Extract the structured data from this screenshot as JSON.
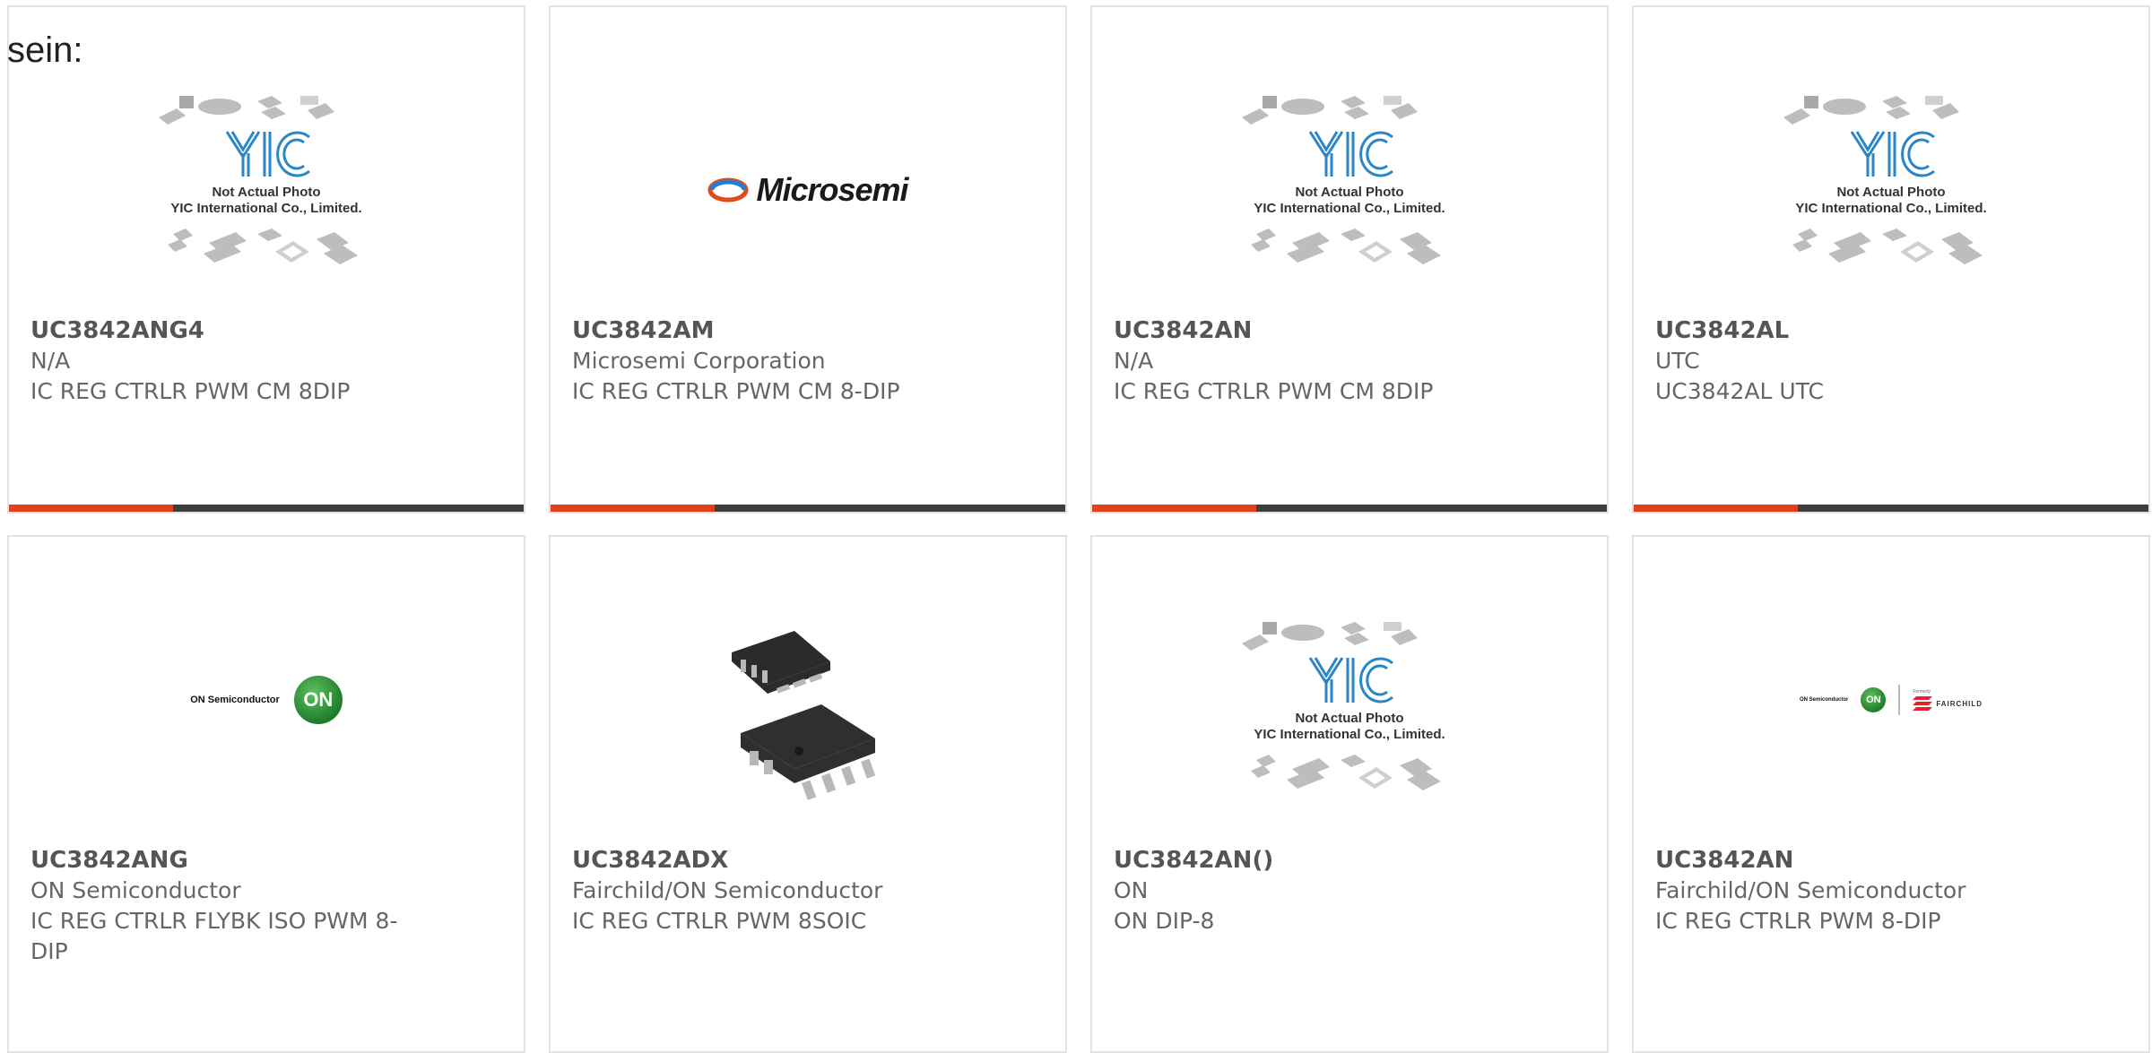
{
  "lead_text": "sein:",
  "colors": {
    "accent": "#e0431c",
    "bar": "#3d3d3d",
    "border": "#e2e2e2"
  },
  "placeholder": {
    "line1": "Not Actual Photo",
    "line2": "YIC International Co., Limited."
  },
  "logos": {
    "microsemi": "Microsemi",
    "on_semiconductor": "ON Semiconductor",
    "on_badge": "ON",
    "fairchild": "FAIRCHILD",
    "fairchild_formerly": "Formerly"
  },
  "products": [
    {
      "part": "UC3842ANG4",
      "manufacturer": "N/A",
      "description": "IC REG CTRLR PWM CM 8DIP",
      "image": "placeholder"
    },
    {
      "part": "UC3842AM",
      "manufacturer": "Microsemi Corporation",
      "description": "IC REG CTRLR PWM CM 8-DIP",
      "image": "microsemi-logo"
    },
    {
      "part": "UC3842AN",
      "manufacturer": "N/A",
      "description": "IC REG CTRLR PWM CM 8DIP",
      "image": "placeholder"
    },
    {
      "part": "UC3842AL",
      "manufacturer": "UTC",
      "description": "UC3842AL UTC",
      "image": "placeholder"
    },
    {
      "part": "UC3842ANG",
      "manufacturer": "ON Semiconductor",
      "description": "IC REG CTRLR FLYBK ISO PWM 8-DIP",
      "image": "on-semiconductor-logo"
    },
    {
      "part": "UC3842ADX",
      "manufacturer": "Fairchild/ON Semiconductor",
      "description": "IC REG CTRLR PWM 8SOIC",
      "image": "soic-chip-photo"
    },
    {
      "part": "UC3842AN()",
      "manufacturer": "ON",
      "description": "ON DIP-8",
      "image": "placeholder"
    },
    {
      "part": "UC3842AN",
      "manufacturer": "Fairchild/ON Semiconductor",
      "description": "IC REG CTRLR PWM 8-DIP",
      "image": "on-fairchild-logo"
    }
  ]
}
